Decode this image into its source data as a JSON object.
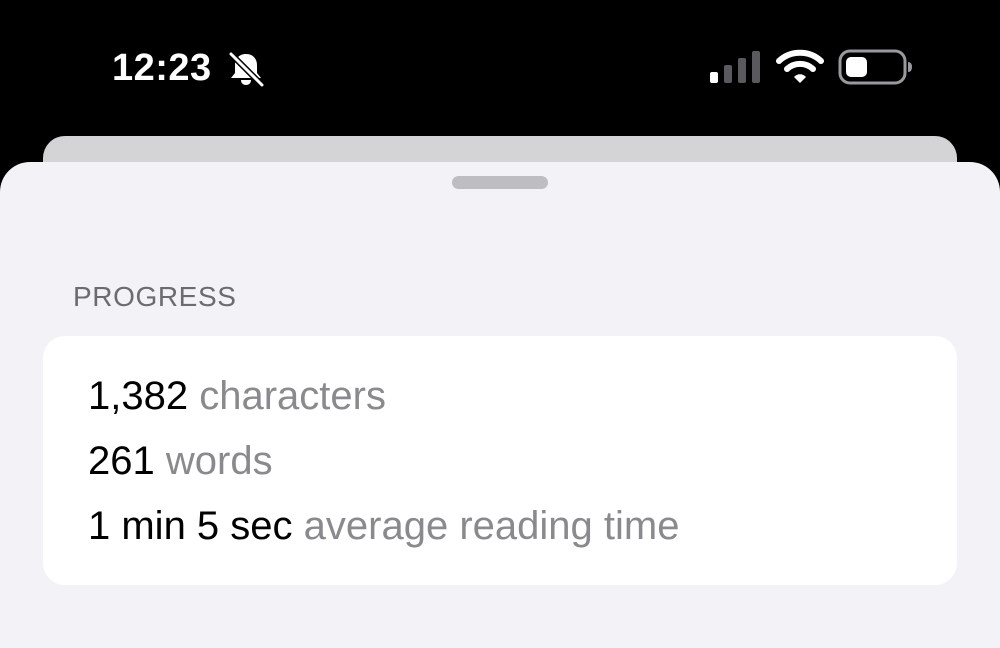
{
  "status_bar": {
    "time": "12:23",
    "icons": [
      "bell-slash-icon",
      "cellular-signal-icon",
      "wifi-icon",
      "battery-icon"
    ],
    "signal_bars_active": 1,
    "signal_bars_total": 4,
    "battery_level": 0.35
  },
  "sheet": {
    "section_title": "PROGRESS",
    "stats": [
      {
        "value": "1,382",
        "label": "characters"
      },
      {
        "value": "261",
        "label": "words"
      },
      {
        "value": "1 min 5 sec",
        "label": "average reading time"
      }
    ]
  },
  "colors": {
    "background": "#f2f2f7",
    "card": "#ffffff",
    "secondary_text": "#8a8a8e",
    "header_text": "#6c6c70"
  }
}
